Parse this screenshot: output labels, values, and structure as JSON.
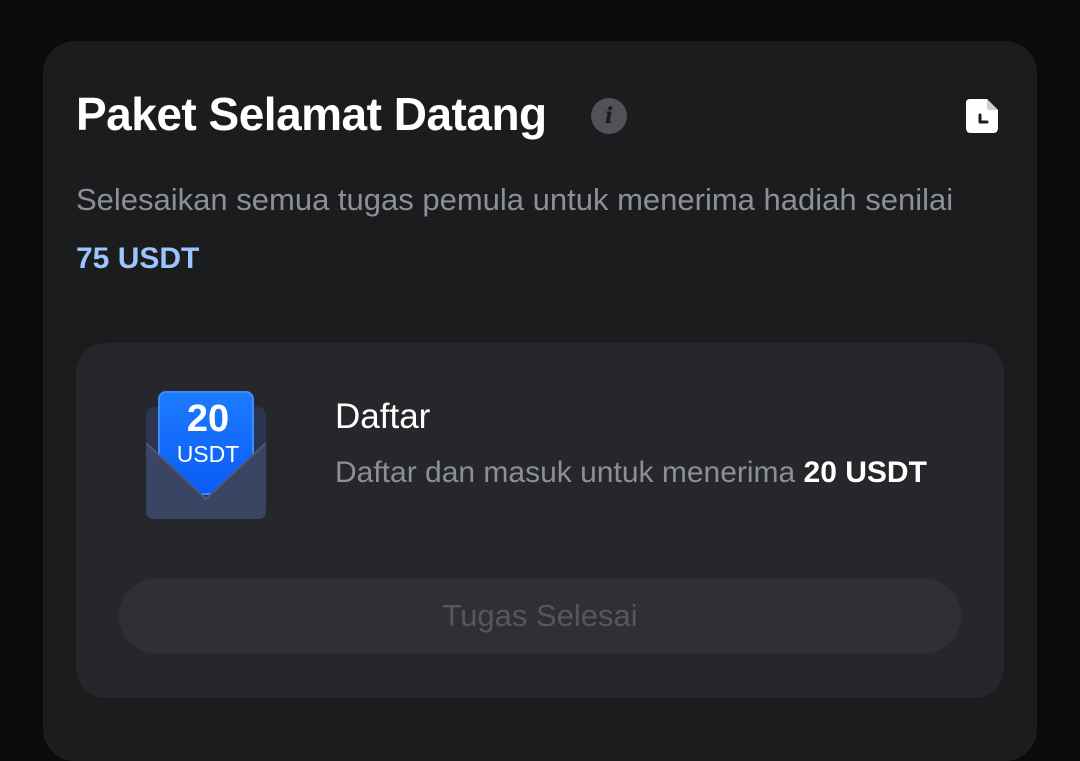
{
  "header": {
    "title": "Paket Selamat Datang",
    "info_glyph": "i",
    "info_icon": "info-icon",
    "history_icon": "history-icon"
  },
  "intro": {
    "text": "Selesaikan semua tugas pemula untuk menerima hadiah senilai",
    "amount": "75 USDT"
  },
  "task": {
    "reward_value": "20",
    "reward_unit": "USDT",
    "title": "Daftar",
    "description_prefix": "Daftar dan masuk untuk menerima ",
    "description_reward": "20 USDT",
    "button_label": "Tugas Selesai",
    "button_state": "disabled"
  },
  "colors": {
    "background": "#0b0b0c",
    "card": "#1b1c1e",
    "task_card": "#26272a",
    "accent_amount": "#9cc4ff",
    "reward_blue": "#1d7bff",
    "muted_text": "#8c8f96",
    "disabled_button": "#2f3034"
  }
}
